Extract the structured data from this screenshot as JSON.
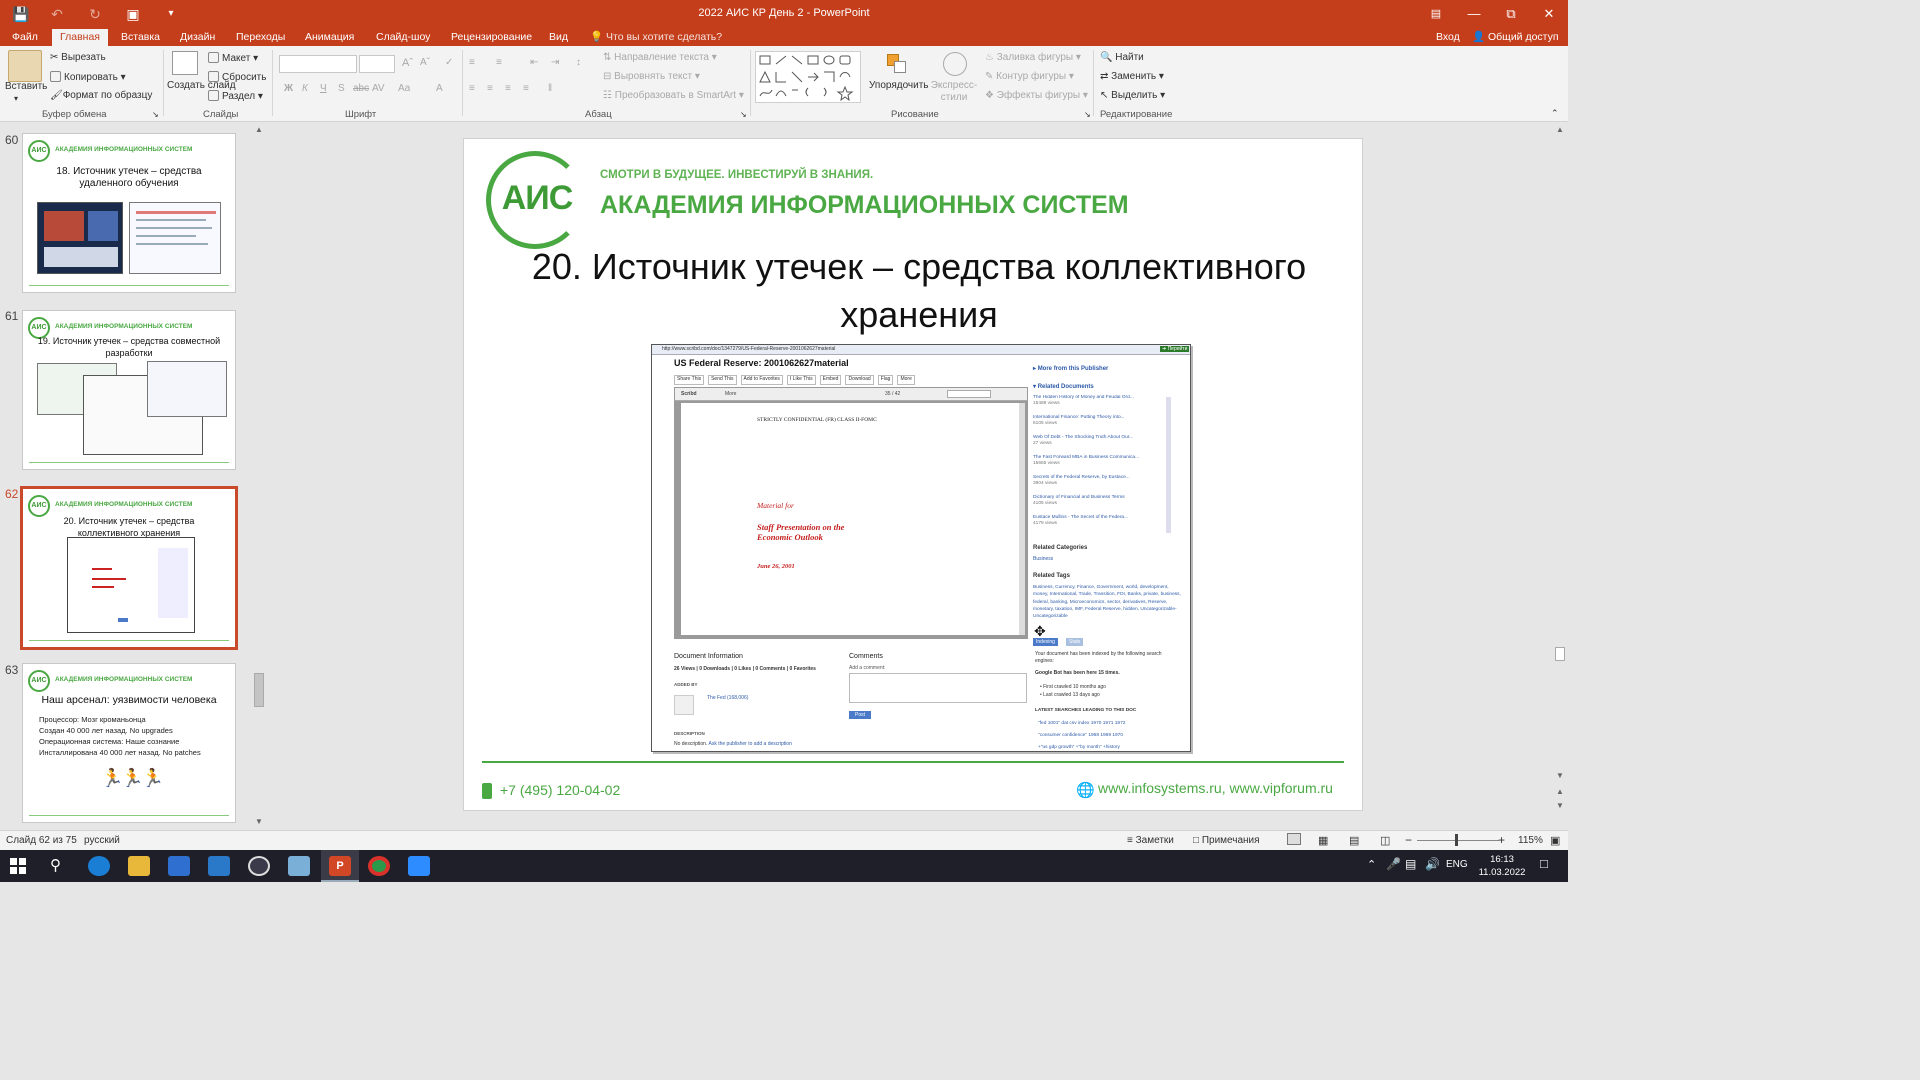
{
  "window": {
    "title": "2022 АИС КР День 2 - PowerPoint",
    "sign_in": "Вход",
    "share": "Общий доступ",
    "tell_me": "Что вы хотите сделать?"
  },
  "tabs": [
    "Файл",
    "Главная",
    "Вставка",
    "Дизайн",
    "Переходы",
    "Анимация",
    "Слайд-шоу",
    "Рецензирование",
    "Вид"
  ],
  "ribbon": {
    "paste": "Вставить",
    "cut": "Вырезать",
    "copy": "Копировать",
    "format_painter": "Формат по образцу",
    "clipboard_group": "Буфер обмена",
    "new_slide": "Создать слайд",
    "layout": "Макет",
    "reset": "Сбросить",
    "section": "Раздел",
    "slides_group": "Слайды",
    "font_group": "Шрифт",
    "paragraph_group": "Абзац",
    "text_direction": "Направление текста",
    "align_text": "Выровнять текст",
    "smartart": "Преобразовать в SmartArt",
    "arrange": "Упорядочить",
    "quick_styles": "Экспресс-стили",
    "shape_fill": "Заливка фигуры",
    "shape_outline": "Контур фигуры",
    "shape_effects": "Эффекты фигуры",
    "drawing_group": "Рисование",
    "find": "Найти",
    "replace": "Заменить",
    "select": "Выделить",
    "editing_group": "Редактирование"
  },
  "thumbnails": [
    {
      "num": "60",
      "title": "18. Источник утечек – средства удаленного обучения",
      "org": "АКАДЕМИЯ ИНФОРМАЦИОННЫХ СИСТЕМ"
    },
    {
      "num": "61",
      "title": "19. Источник утечек – средства совместной разработки",
      "org": "АКАДЕМИЯ ИНФОРМАЦИОННЫХ СИСТЕМ"
    },
    {
      "num": "62",
      "title": "20. Источник утечек – средства коллективного хранения",
      "org": "АКАДЕМИЯ ИНФОРМАЦИОННЫХ СИСТЕМ"
    },
    {
      "num": "63",
      "title": "Наш арсенал: уязвимости человека",
      "org": "АКАДЕМИЯ ИНФОРМАЦИОННЫХ СИСТЕМ",
      "bullets": [
        "Процессор: Мозг кроманьонца",
        "Создан 40 000 лет назад. No upgrades",
        "Операционная система: Наше сознание",
        "Инсталлирована 40 000 лет назад. No patches"
      ]
    }
  ],
  "slide": {
    "logo": "АИС",
    "tagline": "СМОТРИ В БУДУЩЕЕ. ИНВЕСТИРУЙ В ЗНАНИЯ.",
    "org": "АКАДЕМИЯ ИНФОРМАЦИОННЫХ СИСТЕМ",
    "title_line1": "20. Источник утечек – средства коллективного",
    "title_line2": "хранения",
    "phone": "+7 (495) 120-04-02",
    "website": "www.infosystems.ru, www.vipforum.ru",
    "accent": "#4aa843"
  },
  "screenshot": {
    "url": "http://www.scribd.com/doc/1347279/US-Federal-Reserve-2001062627material",
    "doc_title": "US Federal Reserve: 2001062627material",
    "toolbar": [
      "Share This",
      "Send This",
      "Add to Favorites",
      "I Like This",
      "Embed",
      "Download",
      "Flag",
      "More"
    ],
    "page_counter": "35 / 42",
    "scribd": "Scribd",
    "more": "More",
    "confidential": "STRICTLY CONFIDENTIAL (FR) CLASS II-FOMC",
    "material_for": "Material for",
    "presentation_line1": "Staff Presentation on the",
    "presentation_line2": "Economic Outlook",
    "date": "June 26, 2001",
    "more_from": "More from this Publisher",
    "related_documents": "Related Documents",
    "related": [
      {
        "t": "The Hidden History of Money and Feudal Ord...",
        "v": "15488 views"
      },
      {
        "t": "International Finance: Putting Theory into...",
        "v": "6105 views"
      },
      {
        "t": "Web Of Debt - The Shocking Truth About Our...",
        "v": "27 views"
      },
      {
        "t": "The Fast Forward MBA in Business Communica...",
        "v": "15665 views"
      },
      {
        "t": "Secrets of the Federal Reserve, by Eustace...",
        "v": "3904 views"
      },
      {
        "t": "Dictionary of Financial and Business Terms",
        "v": "4105 views"
      },
      {
        "t": "Eustace Mullins - The Secret of the Federa...",
        "v": "4179 views"
      }
    ],
    "related_categories": "Related Categories",
    "category": "Business",
    "related_tags": "Related Tags",
    "tags": "Business, Currency, Finance, Government, world, development, money, International, Trade, Transition, FDI, Banks, private, business, federal, banking, Microeconomics, sector, derivatives, Reserve, monetary, taxation, IMF, Federal Reserve, hidden, Uncategorizable-Uncategorizable",
    "indexing": "Indexing",
    "stats": "Stats",
    "indexed_text": "Your document has been indexed by the following search engines:",
    "googlebot": "Google Bot has been here 15 times.",
    "first_crawled": "First crawled 10 months ago",
    "last_crawled": "Last crawled 13 days ago",
    "latest_searches": "LATEST SEARCHES LEADING TO THIS DOC",
    "searches": [
      "\"fed 1001\" dat csv index 1970 1971 1972",
      "\"consumer confidence\" 1968 1969 1970",
      "+\"us gdp growth\" +\"by month\" +history"
    ],
    "doc_info": "Document Information",
    "doc_stats": "26 Views | 0 Downloads | 0 Likes | 0 Comments | 0 Favorites",
    "added_by": "ADDED BY",
    "user": "The Fed (168,006)",
    "comments": "Comments",
    "add_comment": "Add a comment:",
    "post": "Post",
    "description": "DESCRIPTION",
    "no_description": "No description.",
    "ask_publisher": "Ask the publisher to add a description"
  },
  "status": {
    "slide": "Слайд 62 из 75",
    "lang": "русский",
    "notes": "Заметки",
    "comments": "Примечания",
    "zoom": "115%"
  },
  "taskbar": {
    "lang": "ENG",
    "time": "16:13",
    "date": "11.03.2022"
  }
}
